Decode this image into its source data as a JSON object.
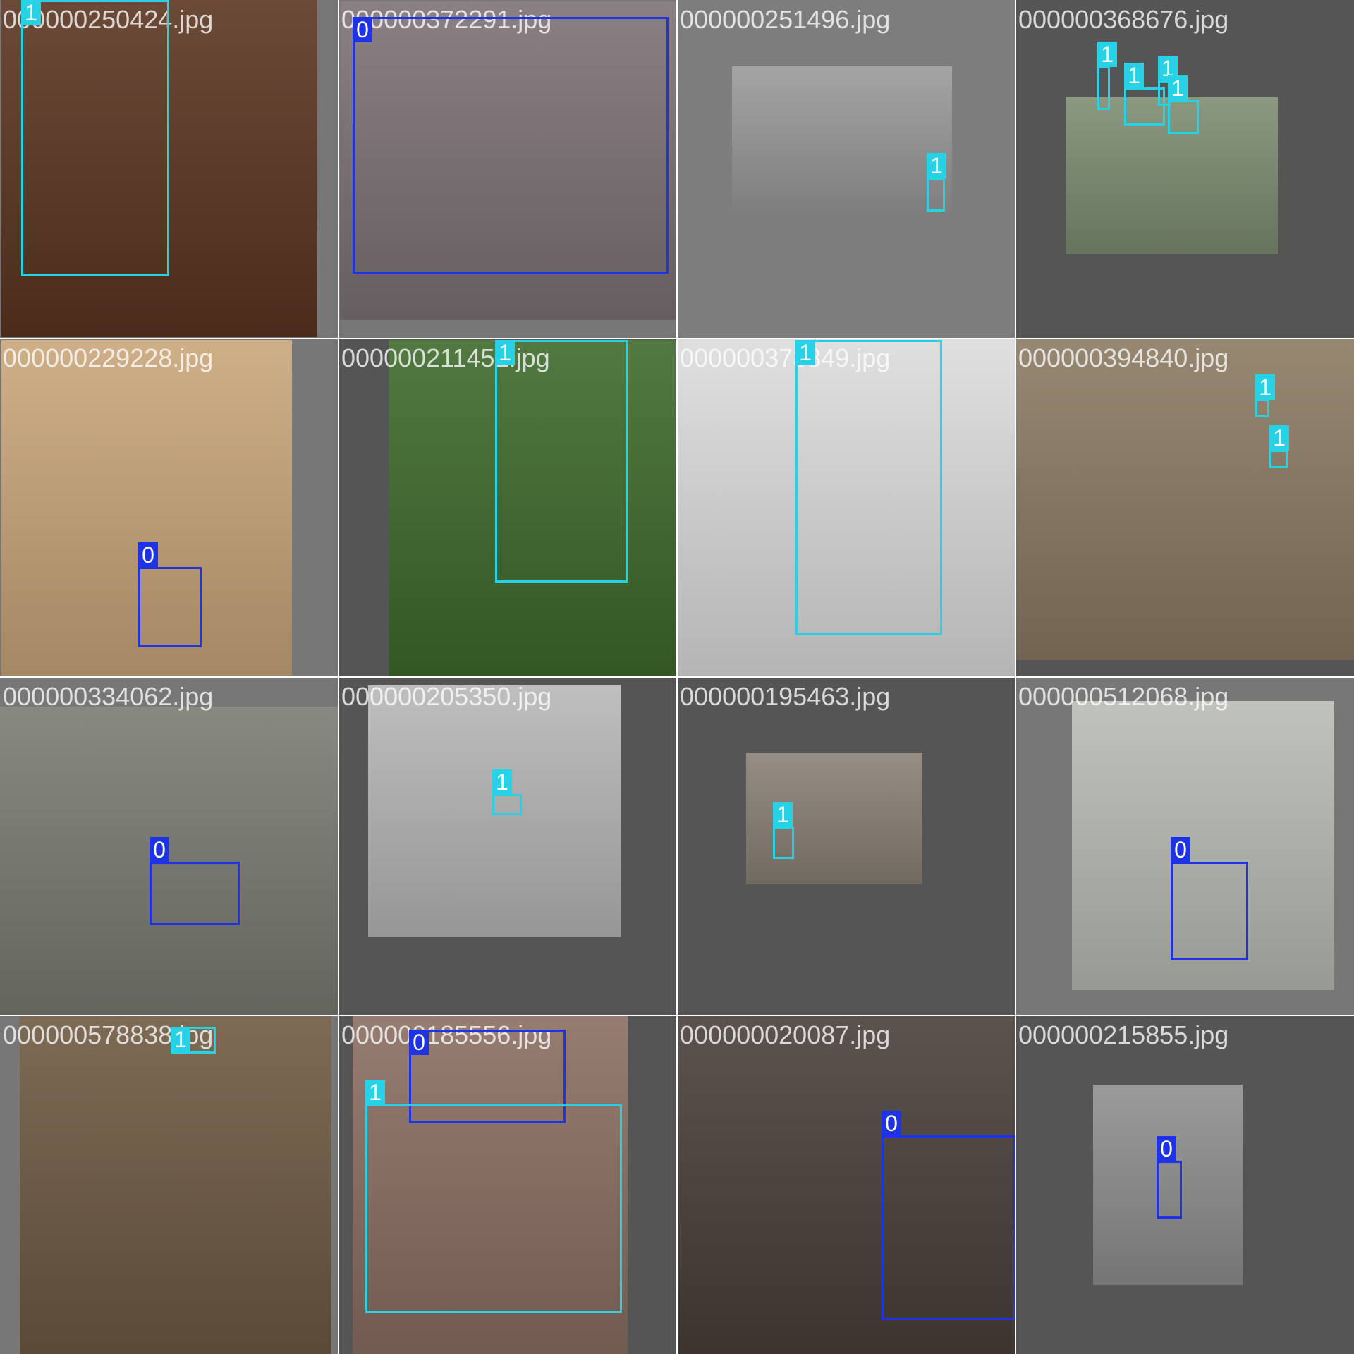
{
  "grid": {
    "columns": 4,
    "rows": 4,
    "background": "#ffffff"
  },
  "classes": {
    "0": {
      "label": "0",
      "color": "#1e32e6"
    },
    "1": {
      "label": "1",
      "color": "#28d2e6"
    }
  },
  "tiles": [
    {
      "filename": "000000250424.jpg",
      "background": "#777777",
      "photo_color": "#5b3521",
      "detections": [
        {
          "class": "1",
          "label": "1"
        }
      ]
    },
    {
      "filename": "000000372291.jpg",
      "background": "#777777",
      "photo_color": "#7d7276",
      "detections": [
        {
          "class": "0",
          "label": "0"
        }
      ]
    },
    {
      "filename": "000000251496.jpg",
      "background": "#7d7d7d",
      "photo_color": "#9a9a9a",
      "detections": [
        {
          "class": "1",
          "label": "1"
        }
      ]
    },
    {
      "filename": "000000368676.jpg",
      "background": "#555555",
      "photo_color": "#7e8d72",
      "detections": [
        {
          "class": "1",
          "label": "1"
        },
        {
          "class": "1",
          "label": "1"
        },
        {
          "class": "1",
          "label": "1"
        },
        {
          "class": "1",
          "label": "1"
        }
      ]
    },
    {
      "filename": "000000229228.jpg",
      "background": "#777777",
      "photo_color": "#c9a67a",
      "detections": [
        {
          "class": "0",
          "label": "0"
        }
      ]
    },
    {
      "filename": "000000211451.jpg",
      "background": "#555555",
      "photo_color": "#3f6a2c",
      "detections": [
        {
          "class": "1",
          "label": "1"
        }
      ]
    },
    {
      "filename": "000000373849.jpg",
      "background": "#555555",
      "photo_color": "#dcdcdc",
      "detections": [
        {
          "class": "1",
          "label": "1"
        }
      ]
    },
    {
      "filename": "000000394840.jpg",
      "background": "#555555",
      "photo_color": "#8b7a62",
      "detections": [
        {
          "class": "1",
          "label": "1"
        },
        {
          "class": "1",
          "label": "1"
        }
      ]
    },
    {
      "filename": "000000334062.jpg",
      "background": "#777777",
      "photo_color": "#7a7b72",
      "detections": [
        {
          "class": "0",
          "label": "0"
        }
      ]
    },
    {
      "filename": "000000205350.jpg",
      "background": "#555555",
      "photo_color": "#b7b7b7",
      "detections": [
        {
          "class": "1",
          "label": "1"
        }
      ]
    },
    {
      "filename": "000000195463.jpg",
      "background": "#555555",
      "photo_color": "#8a8176",
      "detections": [
        {
          "class": "1",
          "label": "1"
        }
      ]
    },
    {
      "filename": "000000512068.jpg",
      "background": "#777777",
      "photo_color": "#b9bcb4",
      "detections": [
        {
          "class": "0",
          "label": "0"
        }
      ]
    },
    {
      "filename": "000000578838.jpg",
      "background": "#777777",
      "photo_color": "#6e5a42",
      "detections": [
        {
          "class": "1",
          "label": "1"
        }
      ]
    },
    {
      "filename": "000000185556.jpg",
      "background": "#555555",
      "photo_color": "#8a6e62",
      "detections": [
        {
          "class": "0",
          "label": "0"
        },
        {
          "class": "1",
          "label": "1"
        }
      ]
    },
    {
      "filename": "000000020087.jpg",
      "background": "#555555",
      "photo_color": "#4a3f3a",
      "detections": [
        {
          "class": "0",
          "label": "0"
        }
      ]
    },
    {
      "filename": "000000215855.jpg",
      "background": "#555555",
      "photo_color": "#8f8f8f",
      "detections": [
        {
          "class": "0",
          "label": "0"
        }
      ]
    }
  ]
}
